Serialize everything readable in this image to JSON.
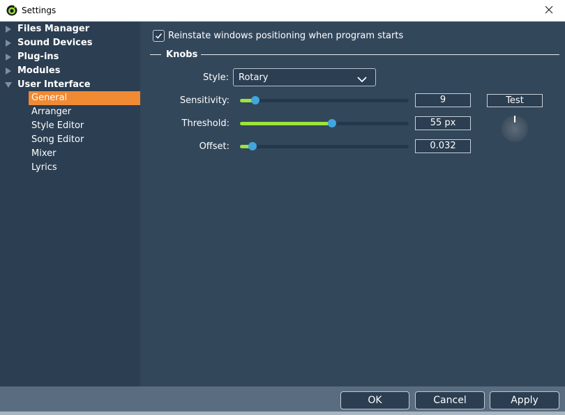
{
  "window": {
    "title": "Settings"
  },
  "sidebar": {
    "categories": [
      {
        "label": "Files Manager",
        "expanded": false
      },
      {
        "label": "Sound Devices",
        "expanded": false
      },
      {
        "label": "Plug-ins",
        "expanded": false
      },
      {
        "label": "Modules",
        "expanded": false
      },
      {
        "label": "User Interface",
        "expanded": true
      }
    ],
    "ui_items": [
      "General",
      "Arranger",
      "Style Editor",
      "Song Editor",
      "Mixer",
      "Lyrics"
    ],
    "active_item": "General"
  },
  "main": {
    "reinstate": {
      "label": "Reinstate windows positioning when program starts",
      "checked": true
    },
    "knobs": {
      "title": "Knobs",
      "style": {
        "label": "Style:",
        "value": "Rotary"
      },
      "sensitivity": {
        "label": "Sensitivity:",
        "value": "9",
        "slider_fraction": 0.09
      },
      "threshold": {
        "label": "Threshold:",
        "value": "55 px",
        "slider_fraction": 0.545
      },
      "offset": {
        "label": "Offset:",
        "value": "0.032",
        "slider_fraction": 0.075
      },
      "test_label": "Test"
    }
  },
  "footer": {
    "ok": "OK",
    "cancel": "Cancel",
    "apply": "Apply"
  },
  "colors": {
    "sidebar_bg": "#2b3e52",
    "panel_bg": "#33475b",
    "active_item": "#f08a33",
    "slider_fill": "#9be53c",
    "slider_thumb": "#42a6de"
  },
  "icons": {
    "app_logo": "app-logo-icon",
    "close": "close-icon",
    "tree_collapsed": "triangle-right-icon",
    "tree_expanded": "triangle-down-icon",
    "check": "checkmark-icon",
    "dropdown": "chevron-down-icon"
  }
}
